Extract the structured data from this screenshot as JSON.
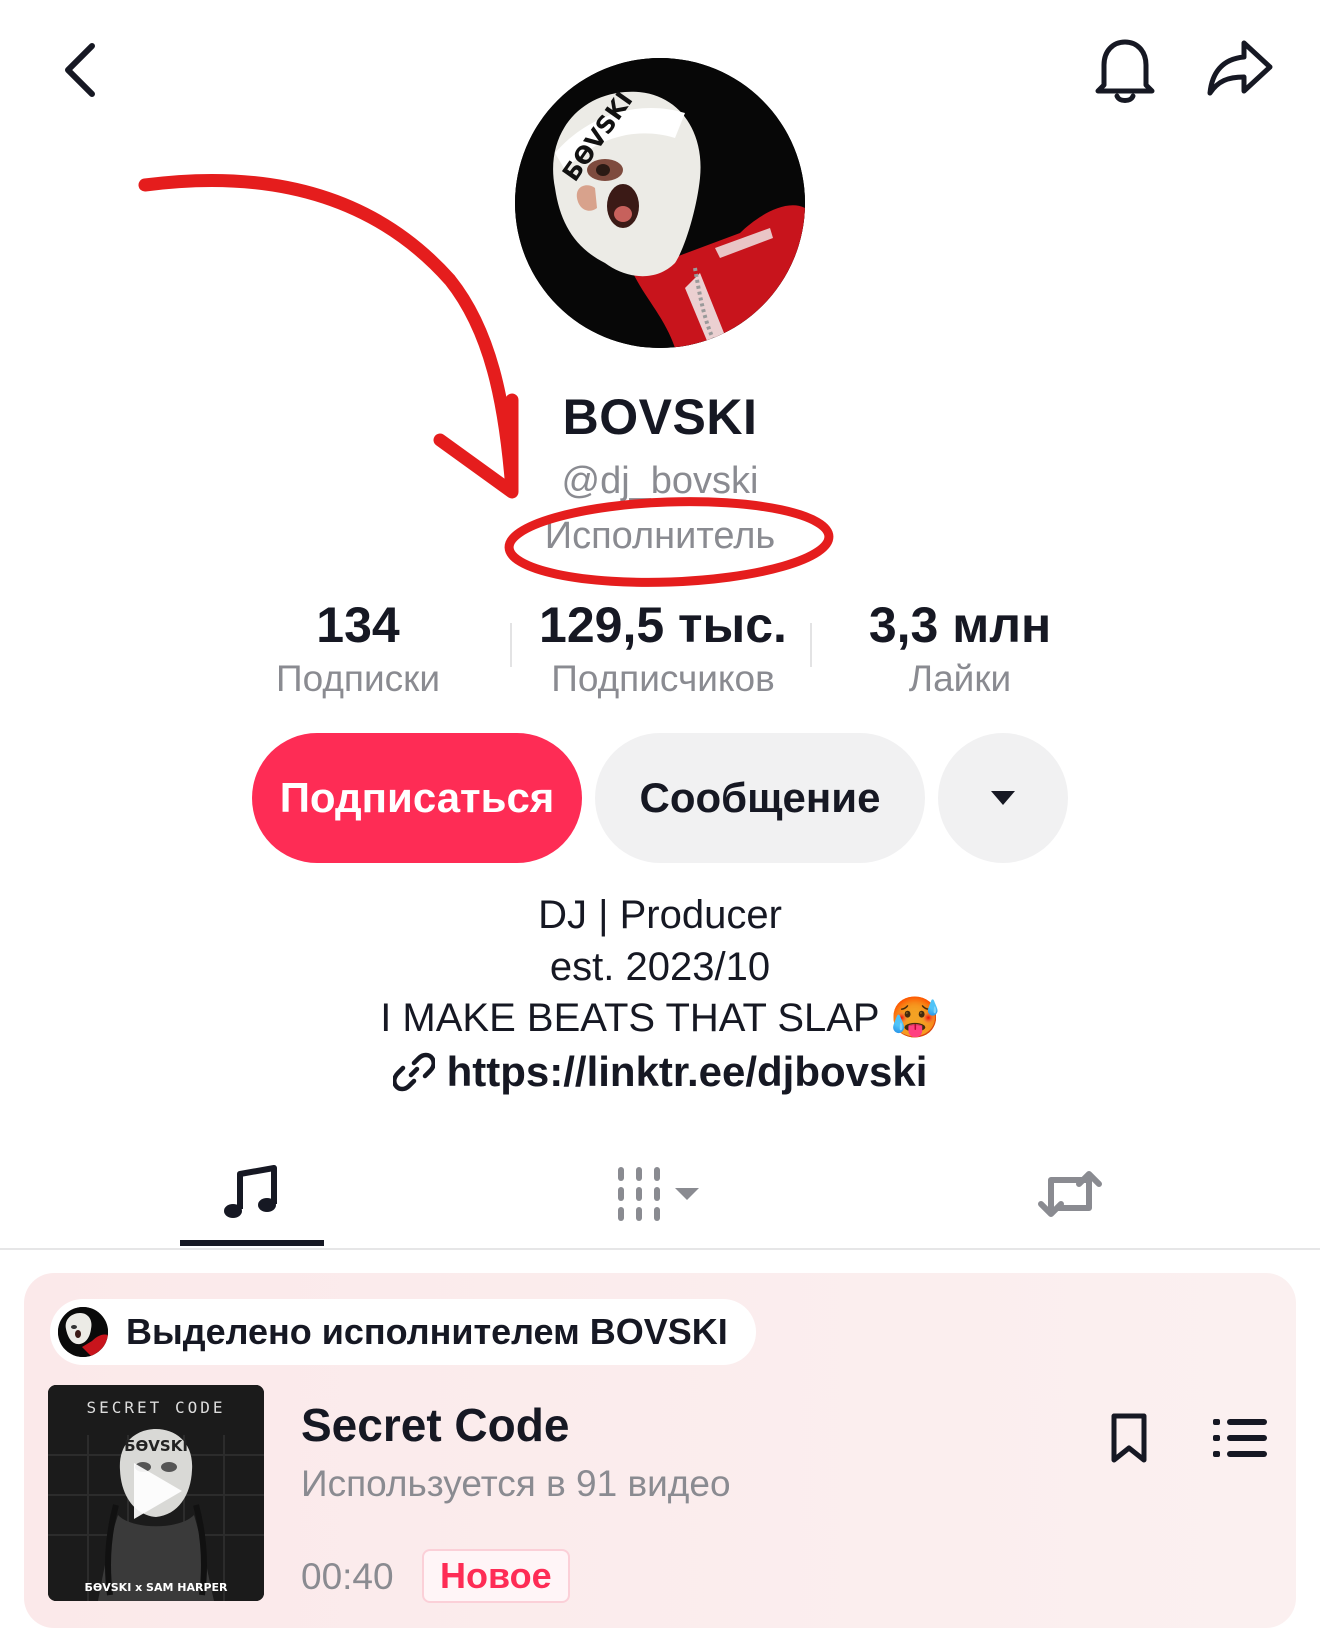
{
  "profile": {
    "name": "BOVSKI",
    "handle": "@dj_bovski",
    "role": "Исполнитель"
  },
  "stats": [
    {
      "value": "134",
      "label": "Подписки"
    },
    {
      "value": "129,5 тыс.",
      "label": "Подписчиков"
    },
    {
      "value": "3,3 млн",
      "label": "Лайки"
    }
  ],
  "actions": {
    "follow": "Подписаться",
    "message": "Сообщение"
  },
  "bio": {
    "line1": "DJ | Producer",
    "line2": "est. 2023/10",
    "line3": "I MAKE BEATS THAT SLAP 🥵",
    "link": "https://linktr.ee/djbovski"
  },
  "icons": {
    "back": "chevron-left-icon",
    "notifications": "bell-icon",
    "share": "share-arrow-icon",
    "more": "caret-down-icon",
    "link": "link-icon",
    "tab_music": "music-note-icon",
    "tab_grid": "grid-filter-icon",
    "tab_repost": "repost-icon",
    "bookmark": "bookmark-icon",
    "playlist": "playlist-icon",
    "play": "play-icon"
  },
  "featured": {
    "pill_text": "Выделено исполнителем BOVSKI",
    "cover_title": "SECRET CODE",
    "cover_mask_text": "БƟVSKI",
    "cover_credits": "БƟVSKI x SAM HARPER",
    "track_title": "Secret Code",
    "usage": "Используется в 91 видео",
    "duration": "00:40",
    "badge": "Новое"
  },
  "avatar": {
    "mask_text": "БƟVSKI"
  },
  "colors": {
    "accent": "#fe2c55",
    "annotation": "#e51d1d",
    "secondary_text": "#8a8b91",
    "button_gray": "#f1f1f2"
  }
}
